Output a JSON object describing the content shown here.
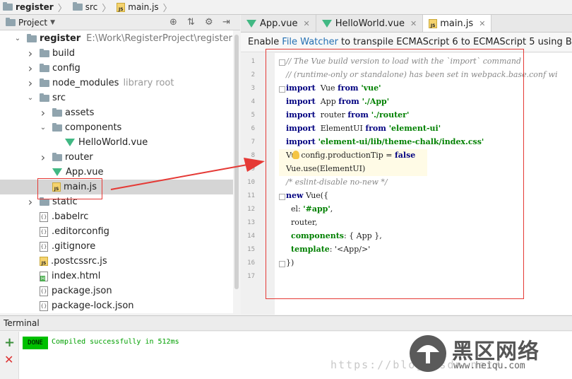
{
  "breadcrumb": [
    "register",
    "src",
    "main.js"
  ],
  "project_panel": {
    "label": "Project",
    "tree": [
      {
        "label": "register",
        "extra": "E:\\Work\\RegisterProject\\register",
        "indent": 0,
        "type": "folder",
        "arrow": "down",
        "bold": true
      },
      {
        "label": "build",
        "indent": 1,
        "type": "folder",
        "arrow": "right"
      },
      {
        "label": "config",
        "indent": 1,
        "type": "folder",
        "arrow": "right"
      },
      {
        "label": "node_modules",
        "lib": "library root",
        "indent": 1,
        "type": "folder",
        "arrow": "right"
      },
      {
        "label": "src",
        "indent": 1,
        "type": "folder",
        "arrow": "down"
      },
      {
        "label": "assets",
        "indent": 2,
        "type": "folder",
        "arrow": "right"
      },
      {
        "label": "components",
        "indent": 2,
        "type": "folder",
        "arrow": "down"
      },
      {
        "label": "HelloWorld.vue",
        "indent": 3,
        "type": "vue",
        "arrow": ""
      },
      {
        "label": "router",
        "indent": 2,
        "type": "folder",
        "arrow": "right"
      },
      {
        "label": "App.vue",
        "indent": 2,
        "type": "vue",
        "arrow": ""
      },
      {
        "label": "main.js",
        "indent": 2,
        "type": "js",
        "arrow": "",
        "selected": true
      },
      {
        "label": "static",
        "indent": 1,
        "type": "folder",
        "arrow": "right"
      },
      {
        "label": ".babelrc",
        "indent": 1,
        "type": "cfg",
        "arrow": ""
      },
      {
        "label": ".editorconfig",
        "indent": 1,
        "type": "cfg",
        "arrow": ""
      },
      {
        "label": ".gitignore",
        "indent": 1,
        "type": "cfg",
        "arrow": ""
      },
      {
        "label": ".postcssrc.js",
        "indent": 1,
        "type": "js",
        "arrow": ""
      },
      {
        "label": "index.html",
        "indent": 1,
        "type": "html",
        "arrow": ""
      },
      {
        "label": "package.json",
        "indent": 1,
        "type": "cfg",
        "arrow": ""
      },
      {
        "label": "package-lock.json",
        "indent": 1,
        "type": "cfg",
        "arrow": ""
      }
    ]
  },
  "tabs": [
    {
      "label": "App.vue",
      "type": "vue",
      "active": false
    },
    {
      "label": "HelloWorld.vue",
      "type": "vue",
      "active": false
    },
    {
      "label": "main.js",
      "type": "js",
      "active": true
    }
  ],
  "banner": {
    "prefix": "Enable",
    "link": "File Watcher",
    "suffix": "to transpile ECMAScript 6 to ECMAScript 5 using Babel?"
  },
  "code_lines": [
    [
      [
        "cm",
        "// The Vue build version to load with the `import` command"
      ]
    ],
    [
      [
        "cm",
        "// (runtime-only or standalone) has been set in webpack.base.conf wi"
      ]
    ],
    [
      [
        "kw",
        "import"
      ],
      [
        "",
        "  Vue "
      ],
      [
        "kw",
        "from"
      ],
      [
        "str",
        " 'vue'"
      ]
    ],
    [
      [
        "kw",
        "import"
      ],
      [
        "",
        "  App "
      ],
      [
        "kw",
        "from"
      ],
      [
        "str",
        " './App'"
      ]
    ],
    [
      [
        "kw",
        "import"
      ],
      [
        "",
        "  router "
      ],
      [
        "kw",
        "from"
      ],
      [
        "str",
        " './router'"
      ]
    ],
    [
      [
        "kw",
        "import"
      ],
      [
        "",
        "  ElementUI "
      ],
      [
        "kw",
        "from"
      ],
      [
        "str",
        " 'element-ui'"
      ]
    ],
    [
      [
        "kw",
        "import"
      ],
      [
        "str",
        " 'element-ui/lib/theme-chalk/index.css'"
      ]
    ],
    [
      [
        "",
        "Vu  config.productionTip = "
      ],
      [
        "kw",
        "false"
      ]
    ],
    [
      [
        "",
        "Vue.use(ElementUI)"
      ]
    ],
    [
      [
        "cm",
        "/* eslint-disable no-new */"
      ]
    ],
    [
      [
        "kw",
        "new"
      ],
      [
        "",
        " Vue({"
      ]
    ],
    [
      [
        "",
        "  el: "
      ],
      [
        "str",
        "'#app'"
      ],
      [
        "",
        ","
      ]
    ],
    [
      [
        "",
        "  router,"
      ]
    ],
    [
      [
        "",
        "  "
      ],
      [
        "str",
        "components"
      ],
      [
        "",
        ": { App },"
      ]
    ],
    [
      [
        "",
        "  "
      ],
      [
        "str",
        "template"
      ],
      [
        "",
        ": '<App/>'"
      ]
    ],
    [
      [
        "",
        "})"
      ]
    ],
    []
  ],
  "terminal": {
    "title": "Terminal",
    "done": "DONE",
    "message": "Compiled successfully in 512ms"
  },
  "watermark": {
    "url": "https://blog.csdn.net/...",
    "brand": "黑区网络",
    "domain": "www.heiqu.com"
  }
}
